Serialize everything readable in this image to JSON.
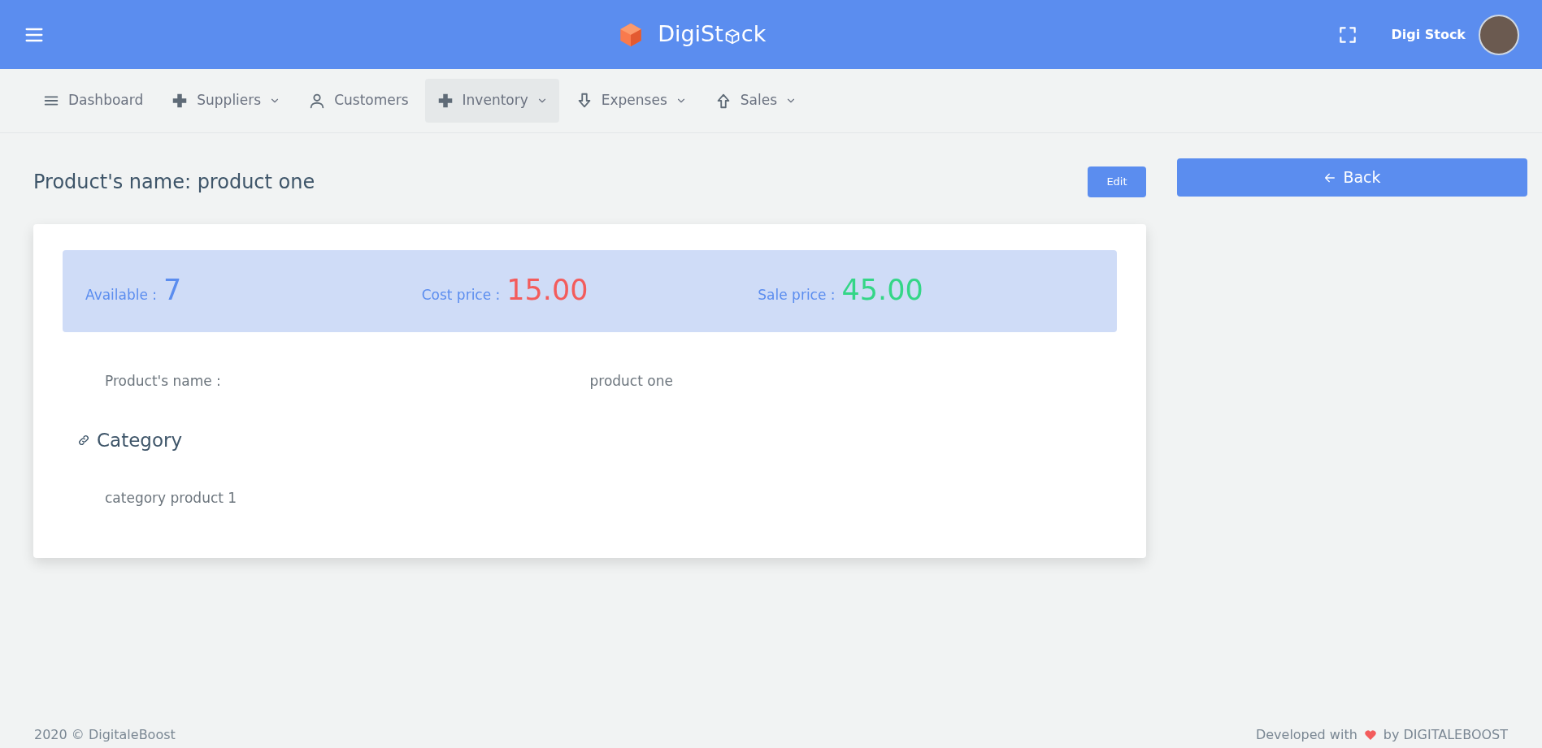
{
  "header": {
    "brand_start": "DigiSt",
    "brand_end": "ck",
    "user_name": "Digi Stock"
  },
  "nav": [
    {
      "label": "Dashboard",
      "dropdown": false,
      "selected": false
    },
    {
      "label": "Suppliers",
      "dropdown": true,
      "selected": false
    },
    {
      "label": "Customers",
      "dropdown": false,
      "selected": false
    },
    {
      "label": "Inventory",
      "dropdown": true,
      "selected": true
    },
    {
      "label": "Expenses",
      "dropdown": true,
      "selected": false
    },
    {
      "label": "Sales",
      "dropdown": true,
      "selected": false
    }
  ],
  "page_title": "Product's name: product one",
  "edit_button": "Edit",
  "back_button": "Back",
  "stats": [
    {
      "label": "Available :",
      "value": "7",
      "color": "#5b8def"
    },
    {
      "label": "Cost price :",
      "value": "15.00",
      "color": "#f35c5c"
    },
    {
      "label": "Sale price :",
      "value": "45.00",
      "color": "#34d687"
    }
  ],
  "details": [
    {
      "label": "Product's name :",
      "value": "product one"
    }
  ],
  "category": {
    "heading": "Category",
    "value": "category product 1"
  },
  "footer": {
    "copyright": "2020 © DigitaleBoost",
    "developed": "Developed with",
    "by": "by DIGITALEBOOST"
  }
}
